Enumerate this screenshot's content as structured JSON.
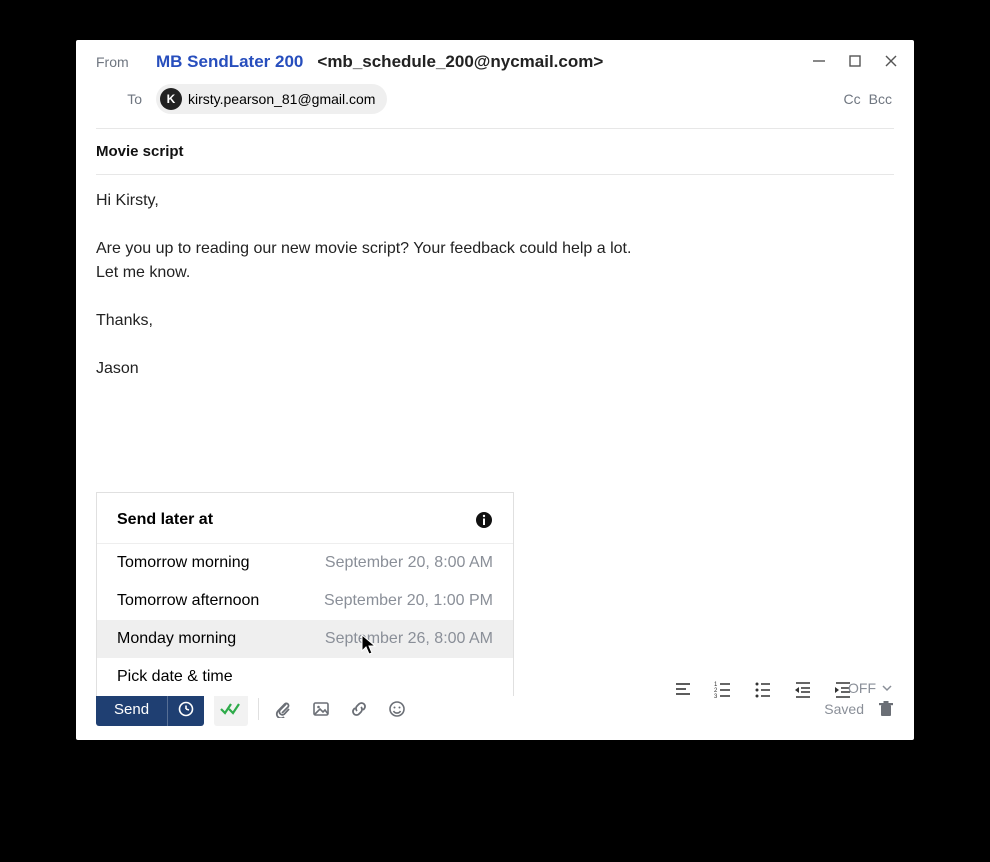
{
  "from": {
    "label": "From",
    "name": "MB SendLater 200",
    "email": "<mb_schedule_200@nycmail.com>"
  },
  "to": {
    "label": "To",
    "recipient_initial": "K",
    "recipient_email": "kirsty.pearson_81@gmail.com",
    "cc_label": "Cc",
    "bcc_label": "Bcc"
  },
  "subject": "Movie script",
  "body": "Hi Kirsty,\n\nAre you up to reading our new movie script? Your feedback could help a lot.\nLet me know.\n\nThanks,\n\nJason",
  "send_later": {
    "title": "Send later at",
    "options": [
      {
        "label": "Tomorrow morning",
        "time": "September 20, 8:00 AM",
        "hovered": false
      },
      {
        "label": "Tomorrow afternoon",
        "time": "September 20, 1:00 PM",
        "hovered": false
      },
      {
        "label": "Monday morning",
        "time": "September 26, 8:00 AM",
        "hovered": true
      }
    ],
    "pick_label": "Pick date & time"
  },
  "toolbar": {
    "send_label": "Send",
    "off_label": "OFF",
    "saved_label": "Saved"
  }
}
